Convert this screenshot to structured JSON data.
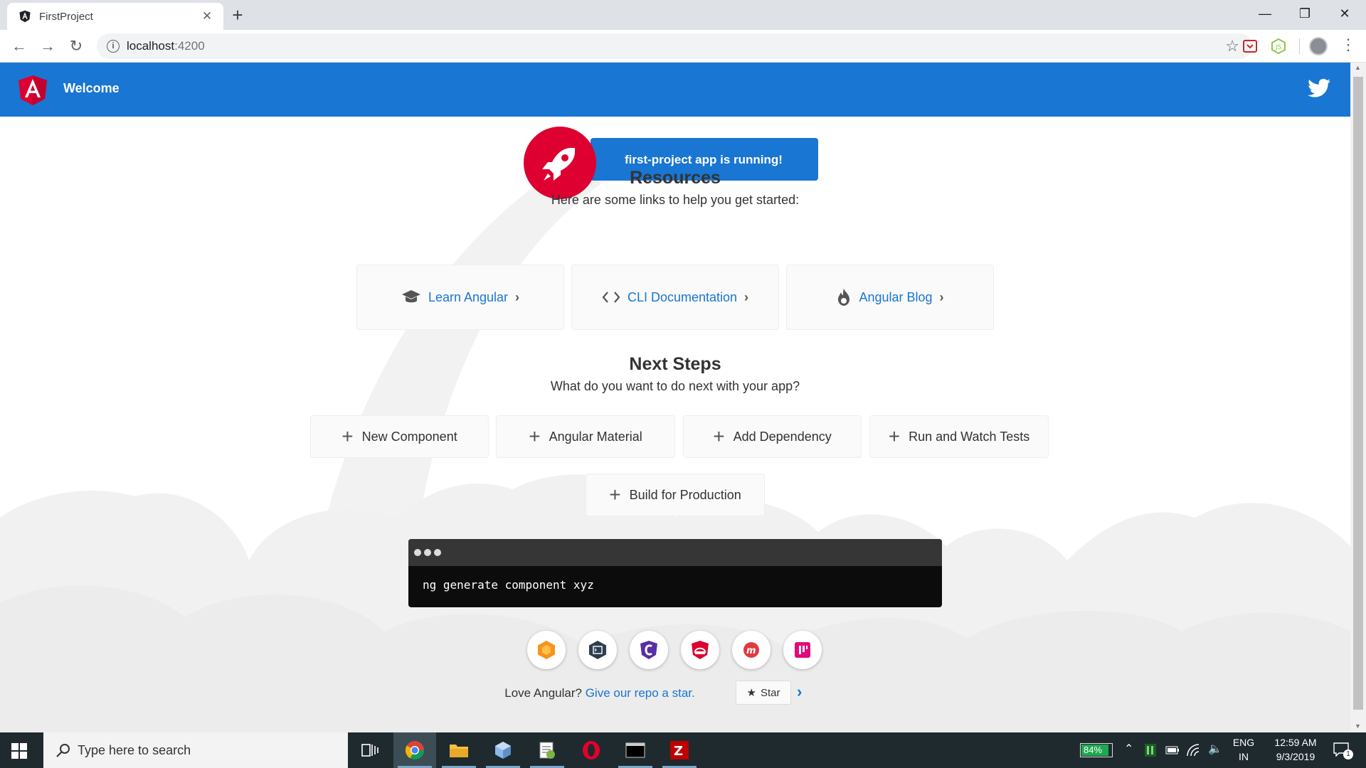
{
  "browser": {
    "tab_title": "FirstProject",
    "new_tab": "+",
    "url_host": "localhost",
    "url_port": ":4200"
  },
  "app": {
    "toolbar_title": "Welcome",
    "running_message": "first-project app is running!"
  },
  "resources": {
    "heading": "Resources",
    "subheading": "Here are some links to help you get started:",
    "links": [
      {
        "label": "Learn Angular",
        "icon": "graduation-cap-icon"
      },
      {
        "label": "CLI Documentation",
        "icon": "code-brackets-icon"
      },
      {
        "label": "Angular Blog",
        "icon": "flame-icon"
      }
    ]
  },
  "next_steps": {
    "heading": "Next Steps",
    "subheading": "What do you want to do next with your app?",
    "cards": [
      {
        "label": "New Component"
      },
      {
        "label": "Angular Material"
      },
      {
        "label": "Add Dependency"
      },
      {
        "label": "Run and Watch Tests"
      },
      {
        "label": "Build for Production"
      }
    ]
  },
  "terminal": {
    "command": "ng generate component xyz"
  },
  "ecosystem_links": [
    {
      "icon": "animations-icon",
      "color": "#f7931e"
    },
    {
      "icon": "cli-icon",
      "color": "#2c3e50"
    },
    {
      "icon": "protractor-icon",
      "color": "#5a2ea6"
    },
    {
      "icon": "angular-pwa-icon",
      "color": "#dd0031"
    },
    {
      "icon": "meetup-icon",
      "color": "#e0393e"
    },
    {
      "icon": "discord-icon",
      "color": "#e4097a"
    }
  ],
  "footer": {
    "love_text": "Love Angular?",
    "repo_link": "Give our repo a star.",
    "star_button": "Star"
  },
  "taskbar": {
    "search_placeholder": "Type here to search",
    "battery": "84%",
    "language_top": "ENG",
    "language_bottom": "IN",
    "time": "12:59 AM",
    "date": "9/3/2019",
    "notification_count": "1"
  },
  "colors": {
    "primary": "#1976d2",
    "angular_red": "#dd0031",
    "taskbar": "#1f2a2f"
  }
}
